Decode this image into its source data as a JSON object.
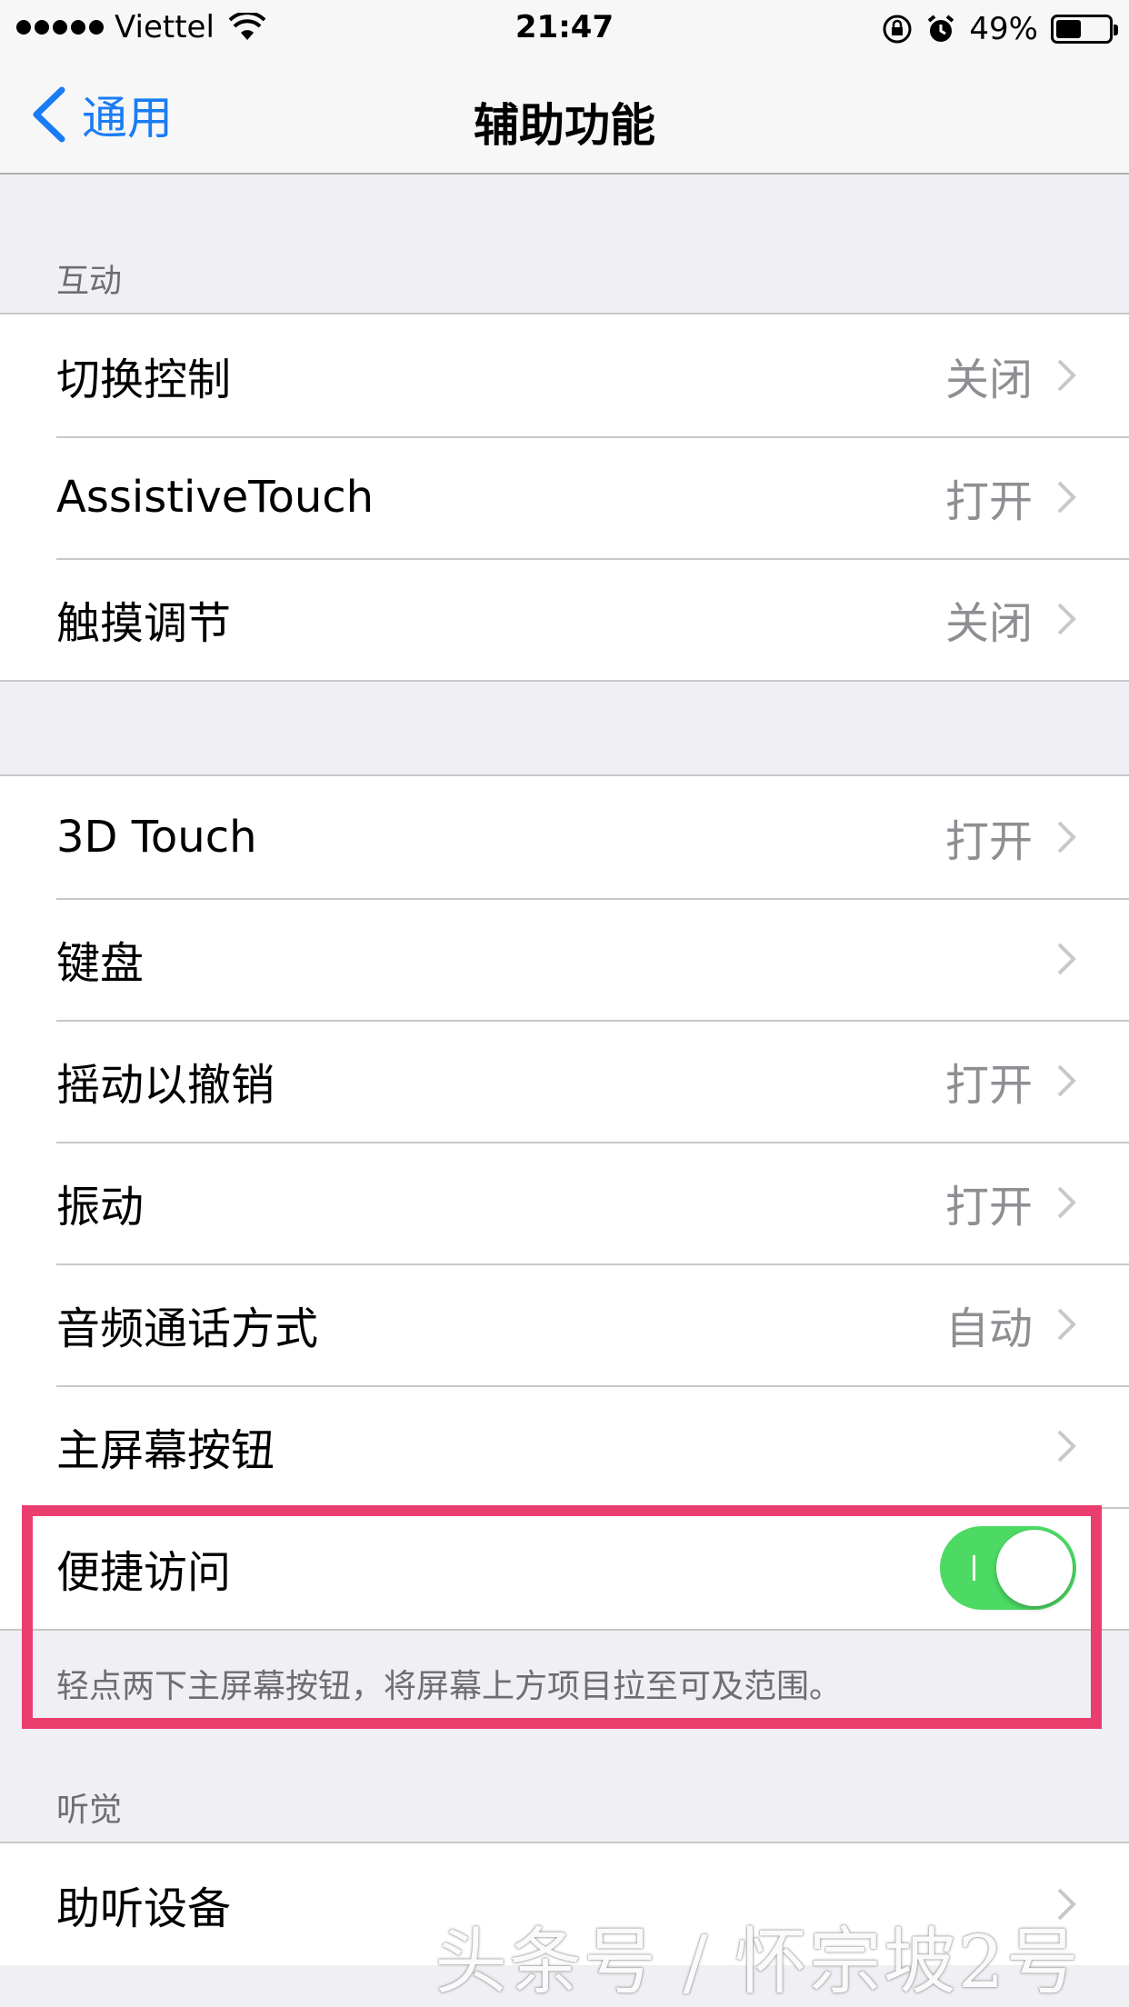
{
  "status": {
    "carrier": "Viettel",
    "time": "21:47",
    "battery_text": "49%",
    "battery_level": 0.49
  },
  "nav": {
    "back_label": "通用",
    "title": "辅助功能"
  },
  "sections": {
    "interaction": {
      "header": "互动"
    },
    "hearing": {
      "header": "听觉"
    }
  },
  "group1": [
    {
      "label": "切换控制",
      "value": "关闭"
    },
    {
      "label": "AssistiveTouch",
      "value": "打开"
    },
    {
      "label": "触摸调节",
      "value": "关闭"
    }
  ],
  "group2": [
    {
      "label": "3D Touch",
      "value": "打开"
    },
    {
      "label": "键盘",
      "value": ""
    },
    {
      "label": "摇动以撤销",
      "value": "打开"
    },
    {
      "label": "振动",
      "value": "打开"
    },
    {
      "label": "音频通话方式",
      "value": "自动"
    },
    {
      "label": "主屏幕按钮",
      "value": ""
    },
    {
      "label": "便捷访问",
      "toggle": true
    }
  ],
  "reachability_note": "轻点两下主屏幕按钮，将屏幕上方项目拉至可及范围。",
  "group3": [
    {
      "label": "助听设备"
    }
  ],
  "watermark": "头条号 / 怀宗坡2号",
  "colors": {
    "accent": "#1a7cf5",
    "toggle_on": "#4cd964",
    "highlight": "#ea3e6e"
  }
}
